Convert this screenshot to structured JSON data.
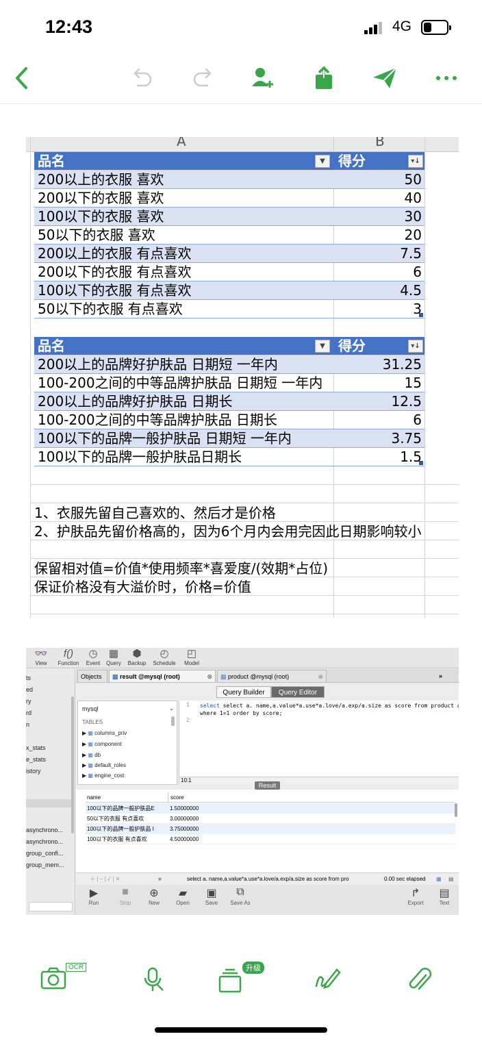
{
  "status": {
    "time": "12:43",
    "network": "4G"
  },
  "toolbar": {
    "back": "back-icon",
    "undo": "undo-icon",
    "redo": "redo-icon",
    "add_user": "add-user-icon",
    "share": "share-icon",
    "send": "send-icon",
    "more": "more-icon",
    "accent": "#3aa64a"
  },
  "sheet": {
    "col_a": "A",
    "col_b": "B",
    "table1": {
      "header_name": "品名",
      "header_score": "得分",
      "rows": [
        {
          "name": "200以上的衣服 喜欢",
          "score": "50"
        },
        {
          "name": "200以下的衣服 喜欢",
          "score": "40"
        },
        {
          "name": "100以下的衣服 喜欢",
          "score": "30"
        },
        {
          "name": "50以下的衣服 喜欢",
          "score": "20"
        },
        {
          "name": "200以上的衣服 有点喜欢",
          "score": "7.5"
        },
        {
          "name": "200以下的衣服 有点喜欢",
          "score": "6"
        },
        {
          "name": "100以下的衣服 有点喜欢",
          "score": "4.5"
        },
        {
          "name": "50以下的衣服 有点喜欢",
          "score": "3"
        }
      ]
    },
    "table2": {
      "header_name": "品名",
      "header_score": "得分",
      "rows": [
        {
          "name": "200以上的品牌好护肤品 日期短 一年内",
          "score": "31.25"
        },
        {
          "name": "100-200之间的中等品牌护肤品 日期短 一年内",
          "score": "15"
        },
        {
          "name": "200以上的品牌好护肤品 日期长",
          "score": "12.5"
        },
        {
          "name": "100-200之间的中等品牌护肤品 日期长",
          "score": "6"
        },
        {
          "name": "100以下的品牌一般护肤品 日期短 一年内",
          "score": "3.75"
        },
        {
          "name": "100以下的品牌一般护肤品日期长",
          "score": "1.5"
        }
      ]
    },
    "notes": [
      "1、衣服先留自己喜欢的、然后才是价格",
      "2、护肤品先留价格高的，因为6个月内会用完因此日期影响较小",
      "保留相对值=价值*使用频率*喜爱度/(效期*占位)",
      "保证价格没有大溢价时，价格=价值"
    ],
    "header_color": "#4472c4",
    "band_color": "#d9e1f2"
  },
  "mysql": {
    "tools": [
      {
        "icon": "view-icon",
        "label": "View"
      },
      {
        "icon": "function-icon",
        "label": "Function"
      },
      {
        "icon": "event-icon",
        "label": "Event"
      },
      {
        "icon": "query-icon",
        "label": "Query"
      },
      {
        "icon": "backup-icon",
        "label": "Backup"
      },
      {
        "icon": "schedule-icon",
        "label": "Schedule"
      },
      {
        "icon": "model-icon",
        "label": "Model"
      }
    ],
    "left_items": [
      "ts",
      "ed",
      "ry",
      "rd",
      "n",
      "x_stats",
      "e_stats",
      "istory"
    ],
    "left_items2": [
      "asynchrono...",
      "asynchrono...",
      "group_confi...",
      "group_mem..."
    ],
    "tabs": {
      "objects": "Objects",
      "result": "result @mysql (root)",
      "product": "product @mysql (root)"
    },
    "seg": {
      "builder": "Query Builder",
      "editor": "Query Editor"
    },
    "db": "mysql",
    "tables_label": "TABLES",
    "tables": [
      "columns_priv",
      "component",
      "db",
      "default_roles",
      "engine_cost"
    ],
    "line1": "select a.",
    "line1b": "name,a.value*a.use*a.love/a.exp/a.size as score from product a",
    "line2": "where 1=1 order by score;",
    "cursor": "10:1",
    "result_label": "Result",
    "col_name": "name",
    "col_score": "score",
    "rows": [
      {
        "name": "100以下的品牌一般护肤品E",
        "score": "1.50000000"
      },
      {
        "name": "50以下的衣服 有点喜欢",
        "score": "3.00000000"
      },
      {
        "name": "100以下的品牌一般护肤品 I",
        "score": "3.75000000"
      },
      {
        "name": "100以下的衣服 有点喜欢",
        "score": "4.50000000"
      }
    ],
    "status_sql": "select a. name,a.value*a.use*a.love/a.exp/a.size as score from pro",
    "elapsed": "0.00 sec elapsed",
    "buttons": {
      "run": "Run",
      "stop": "Stop",
      "new": "New",
      "open": "Open",
      "save": "Save",
      "saveas": "Save As",
      "export": "Export",
      "text": "Text"
    }
  },
  "bottom": {
    "ocr": "OCR",
    "upgrade": "升级",
    "icons": [
      "camera-icon",
      "mic-icon",
      "layers-icon",
      "scribble-icon",
      "attach-icon"
    ]
  }
}
